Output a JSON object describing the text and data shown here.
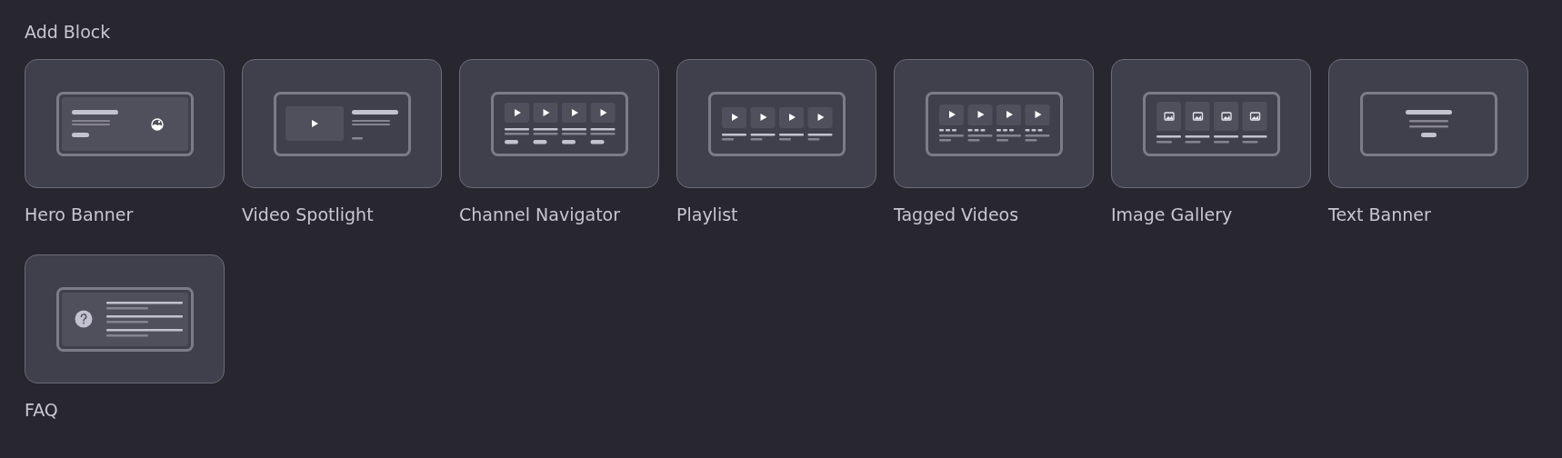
{
  "title": "Add Block",
  "blocks": [
    {
      "label": "Hero Banner",
      "kind": "hero"
    },
    {
      "label": "Video Spotlight",
      "kind": "spotlight"
    },
    {
      "label": "Channel Navigator",
      "kind": "channels"
    },
    {
      "label": "Playlist",
      "kind": "playlist"
    },
    {
      "label": "Tagged Videos",
      "kind": "tagged"
    },
    {
      "label": "Image Gallery",
      "kind": "gallery"
    },
    {
      "label": "Text Banner",
      "kind": "text"
    },
    {
      "label": "FAQ",
      "kind": "faq"
    }
  ]
}
